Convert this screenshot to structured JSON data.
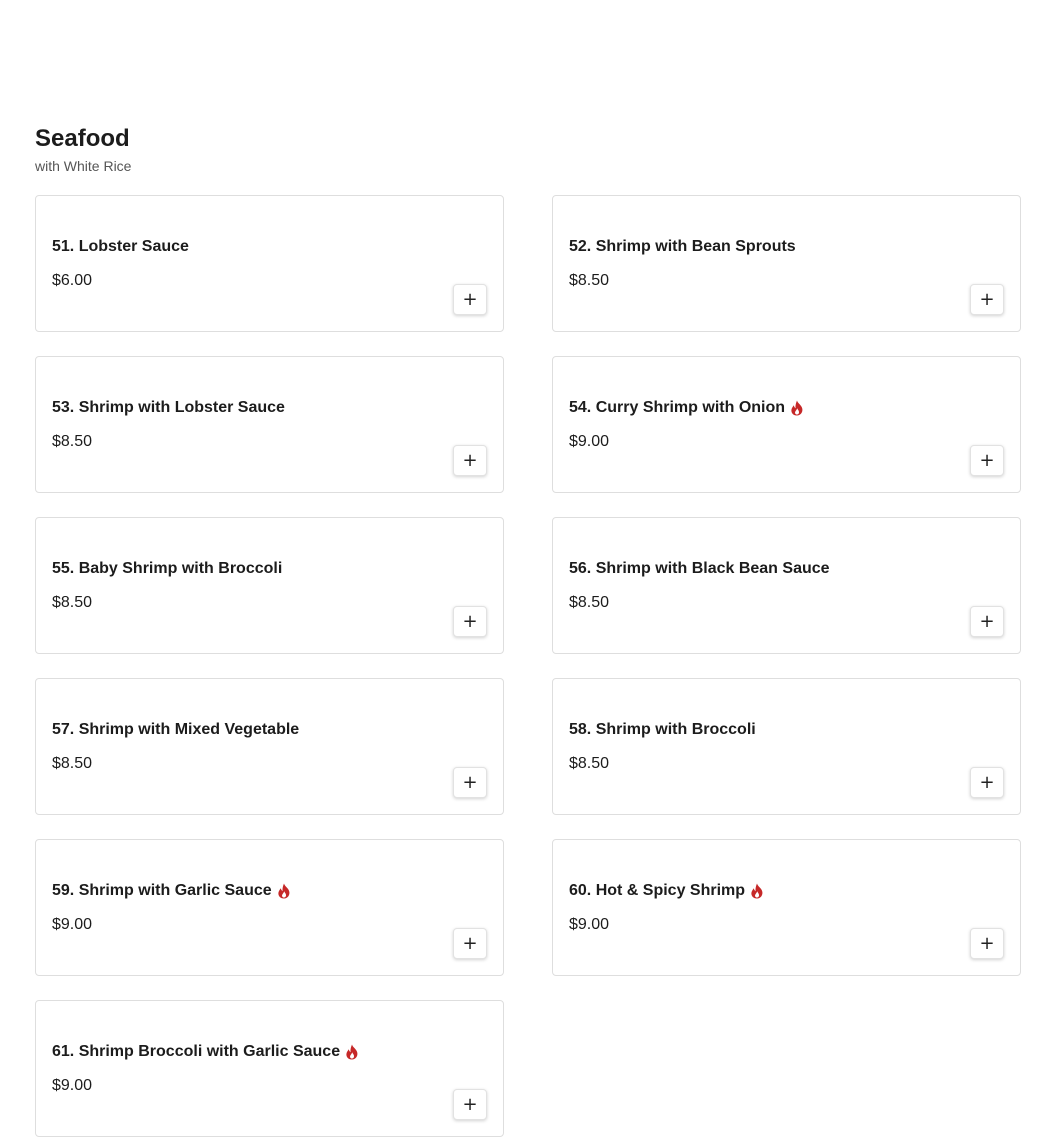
{
  "section": {
    "title": "Seafood",
    "subtitle": "with White Rice"
  },
  "colors": {
    "spicy": "#c62828",
    "border": "#dedede",
    "text": "#1c1c1c"
  },
  "add_button_icon": "plus-icon",
  "items": [
    {
      "name": "51. Lobster Sauce",
      "price": "$6.00",
      "spicy": false
    },
    {
      "name": "52. Shrimp with Bean Sprouts",
      "price": "$8.50",
      "spicy": false
    },
    {
      "name": "53. Shrimp with Lobster Sauce",
      "price": "$8.50",
      "spicy": false
    },
    {
      "name": "54. Curry Shrimp with Onion",
      "price": "$9.00",
      "spicy": true
    },
    {
      "name": "55. Baby Shrimp with Broccoli",
      "price": "$8.50",
      "spicy": false
    },
    {
      "name": "56. Shrimp with Black Bean Sauce",
      "price": "$8.50",
      "spicy": false
    },
    {
      "name": "57. Shrimp with Mixed Vegetable",
      "price": "$8.50",
      "spicy": false
    },
    {
      "name": "58. Shrimp with Broccoli",
      "price": "$8.50",
      "spicy": false
    },
    {
      "name": "59. Shrimp with Garlic Sauce",
      "price": "$9.00",
      "spicy": true
    },
    {
      "name": "60. Hot & Spicy Shrimp",
      "price": "$9.00",
      "spicy": true
    },
    {
      "name": "61. Shrimp Broccoli with Garlic Sauce",
      "price": "$9.00",
      "spicy": true
    }
  ]
}
